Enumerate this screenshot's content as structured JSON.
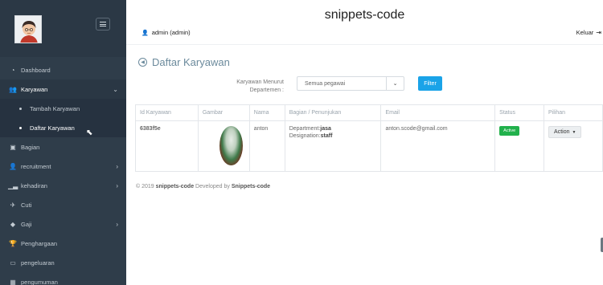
{
  "header": {
    "title": "snippets-code",
    "user": "admin (admin)",
    "logout": "Keluar"
  },
  "sidebar": {
    "items": [
      {
        "label": "Dashboard",
        "icon": "dashboard-icon"
      },
      {
        "label": "Karyawan",
        "icon": "users-icon",
        "open": true
      },
      {
        "label": "Bagian",
        "icon": "briefcase-icon"
      },
      {
        "label": "recruitment",
        "icon": "user-plus-icon"
      },
      {
        "label": "kehadiran",
        "icon": "bar-chart-icon"
      },
      {
        "label": "Cuti",
        "icon": "plane-icon"
      },
      {
        "label": "Gaji",
        "icon": "money-icon"
      },
      {
        "label": "Penghargaan",
        "icon": "trophy-icon"
      },
      {
        "label": "pengeluaran",
        "icon": "credit-card-icon"
      },
      {
        "label": "pengumuman",
        "icon": "calendar-icon"
      }
    ],
    "submenu": [
      {
        "label": "Tambah Karyawan"
      },
      {
        "label": "Daftar Karyawan",
        "active": true
      }
    ]
  },
  "page": {
    "title": "Daftar Karyawan",
    "filter_label": "Karyawan Menurut Departemen :",
    "filter_select": "Semua pegawai",
    "filter_button": "Filter"
  },
  "table": {
    "headers": [
      "Id Karyawan",
      "Gambar",
      "Nama",
      "Bagian / Penunjukan",
      "Email",
      "Status",
      "Pilihan"
    ],
    "rows": [
      {
        "id": "6383f5e",
        "nama": "anton",
        "department_label": "Department:",
        "department": "jasa",
        "designation_label": "Designation:",
        "designation": "staff",
        "email": "anton.scode@gmail.com",
        "status": "Active",
        "action": "Action"
      }
    ]
  },
  "footer": {
    "prefix": "© 2019",
    "brand": "snippets-code",
    "middle": "Developed by",
    "author": "Snippets-code"
  },
  "colors": {
    "sidebar": "#2f3d4a",
    "accent": "#1aa3e8",
    "active_badge": "#22b14c"
  }
}
